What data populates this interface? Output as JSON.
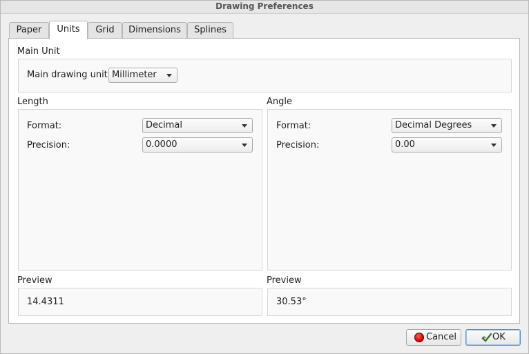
{
  "window": {
    "title": "Drawing Preferences"
  },
  "tabs": [
    {
      "label": "Paper"
    },
    {
      "label": "Units"
    },
    {
      "label": "Grid"
    },
    {
      "label": "Dimensions"
    },
    {
      "label": "Splines"
    }
  ],
  "active_tab": "Units",
  "main_unit": {
    "section_title": "Main Unit",
    "label": "Main drawing unit:",
    "value": "Millimeter"
  },
  "length": {
    "section_title": "Length",
    "format_label": "Format:",
    "format_value": "Decimal",
    "precision_label": "Precision:",
    "precision_value": "0.0000",
    "preview_title": "Preview",
    "preview_value": "14.4311"
  },
  "angle": {
    "section_title": "Angle",
    "format_label": "Format:",
    "format_value": "Decimal Degrees",
    "precision_label": "Precision:",
    "precision_value": "0.00",
    "preview_title": "Preview",
    "preview_value": "30.53°"
  },
  "buttons": {
    "cancel_label": "Cancel",
    "ok_label": "OK"
  },
  "icons": {
    "cancel": "stop-red-circle-icon",
    "ok": "check-arrow-icon"
  }
}
